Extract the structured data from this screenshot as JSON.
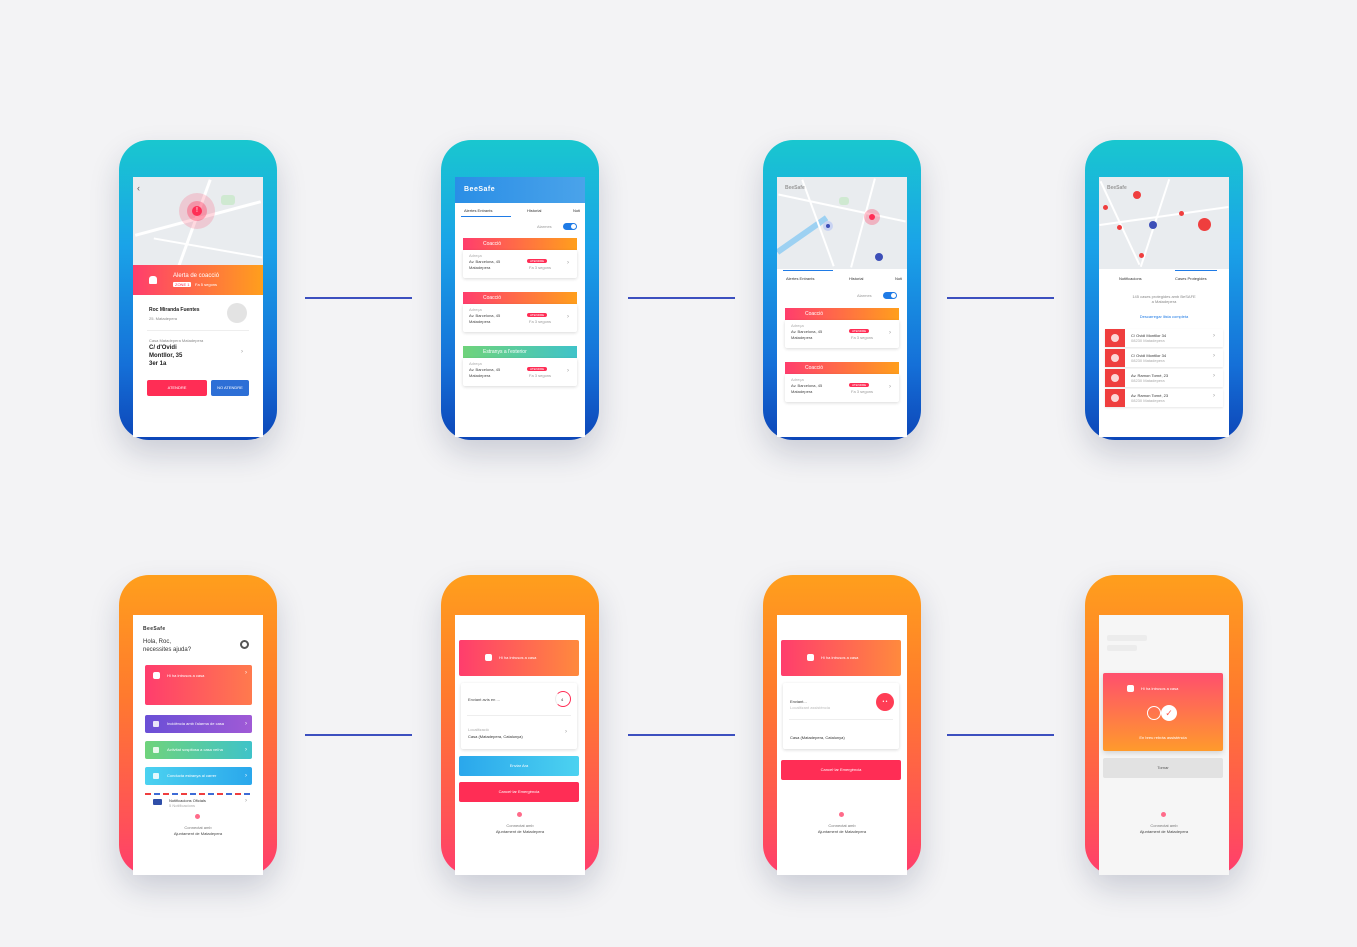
{
  "phone1": {
    "alert_title": "Alerta de coacció",
    "alert_tag": "ZONE 1",
    "alert_time": "Fa 5 segons",
    "person_name": "Roc Miranda Fuentes",
    "person_location": "25. Matadepera",
    "address_label": "Casa Matadepera Matadepera",
    "address_line1": "C/ d'Ovidi",
    "address_line2": "Montllor, 35",
    "address_line3": "3er 1a",
    "btn_attend": "ATENDRE",
    "btn_no_attend": "NO ATENDRE"
  },
  "phone2": {
    "logo": "BeeSafe",
    "tabs": [
      "Alertes Entrants",
      "Historial",
      "Noti"
    ],
    "toggle_label": "Alarmes",
    "cards": [
      {
        "title": "Coacció",
        "small": "Adreça",
        "addr1": "Av. Barcelona, 45",
        "addr2": "Matadepera",
        "badge": "ATENDRE",
        "time": "Fa 3 segons"
      },
      {
        "title": "Coacció",
        "small": "Adreça",
        "addr1": "Av. Barcelona, 45",
        "addr2": "Matadepera",
        "badge": "ATENDRE",
        "time": "Fa 3 segons"
      },
      {
        "title": "Estranys a l'exterior",
        "small": "Adreça",
        "addr1": "Av. Barcelona, 45",
        "addr2": "Matadepera",
        "badge": "ATENDRE",
        "time": "Fa 3 segons"
      }
    ]
  },
  "phone3": {
    "logo": "BeeSafe",
    "tabs": [
      "Alertes Entrants",
      "Historial",
      "Noti"
    ],
    "toggle_label": "Alarmes",
    "cards": [
      {
        "title": "Coacció",
        "small": "Adreça",
        "addr1": "Av. Barcelona, 45",
        "addr2": "Matadepera",
        "badge": "ATENDRE",
        "time": "Fa 3 segons"
      },
      {
        "title": "Coacció",
        "small": "Adreça",
        "addr1": "Av. Barcelona, 45",
        "addr2": "Matadepera",
        "badge": "ATENDRE",
        "time": "Fa 3 segons"
      }
    ]
  },
  "phone4": {
    "logo": "BeeSafe",
    "tabs": [
      "Notificacions",
      "Cases Protegides"
    ],
    "summary_line1": "145 cases protegides amb BeSAFE",
    "summary_line2": "a Matadepera",
    "download_link": "Descarregar llista completa",
    "rows": [
      {
        "addr": "C/ Ovidi Montllor 34",
        "city": "08230 Matadepera"
      },
      {
        "addr": "C/ Ovidi Montllor 34",
        "city": "08230 Matadepera"
      },
      {
        "addr": "Av. Ramon Torné, 23",
        "city": "08230 Matadepera"
      },
      {
        "addr": "Av. Ramon Torné, 23",
        "city": "08230 Matadepera"
      }
    ]
  },
  "phone5": {
    "logo": "BeeSafe",
    "greeting1": "Hola, Roc,",
    "greeting2": "necessites ajuda?",
    "menu": [
      "Hi ha intrusos a casa",
      "Incidència amb l'alarma de casa",
      "Activitat sospitosa a casa veïna",
      "Conducta estranya al carrer"
    ],
    "notif_title": "Notificacions Oficials",
    "notif_sub": "5 Notificacions",
    "footer1": "Connectat amb",
    "footer2": "Ajuntament de Matadepera"
  },
  "phone6": {
    "header": "Hi ha intrusos a casa",
    "sending": "Enviant avís en ...",
    "countdown": "4",
    "location_label": "Localització",
    "location": "Casa (Matadepera, Catalunya)",
    "btn_send": "Enviar Ara",
    "btn_cancel": "Cancel·lar Emergència",
    "footer1": "Connectat amb",
    "footer2": "Ajuntament de Matadepera"
  },
  "phone7": {
    "header": "Hi ha intrusos a casa",
    "sending": "Enviant...",
    "sending_sub": "Localitzant assistència",
    "location": "Casa (Matadepera, Catalunya)",
    "btn_cancel": "Cancel·lar Emergència",
    "footer1": "Connectat amb",
    "footer2": "Ajuntament de Matadepera"
  },
  "phone8": {
    "header": "Hi ha intrusos a casa",
    "message": "En breu rebràs assistència",
    "btn_back": "Tornar",
    "footer1": "Connectat amb",
    "footer2": "Ajuntament de Matadepera"
  },
  "colors": {
    "blue_accent": "#1f7be6",
    "red_accent": "#ff2d55",
    "orange_accent": "#ff9f1c",
    "connector": "#3c4fbf"
  }
}
